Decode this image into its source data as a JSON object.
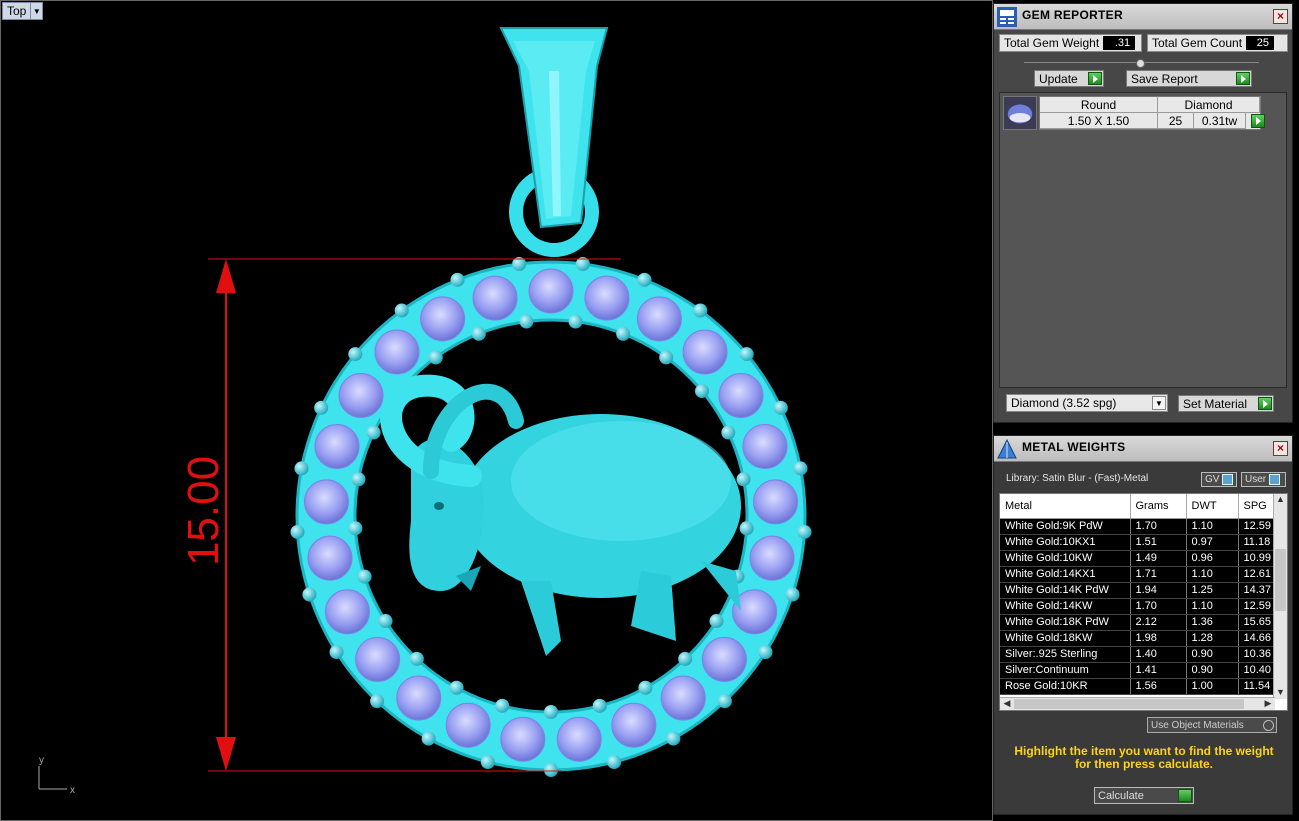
{
  "viewport": {
    "view_name": "Top",
    "dimension_value": "15.00",
    "axis_y": "y",
    "axis_x": "x"
  },
  "gem_reporter": {
    "title": "GEM REPORTER",
    "total_gem_weight_label": "Total Gem Weight",
    "total_gem_weight_value": ".31",
    "total_gem_count_label": "Total Gem Count",
    "total_gem_count_value": "25",
    "update_label": "Update",
    "save_report_label": "Save Report",
    "gems": [
      {
        "shape": "Round",
        "material": "Diamond",
        "size": "1.50 X 1.50",
        "count": "25",
        "weight": "0.31tw"
      }
    ],
    "material_select": "Diamond    (3.52 spg)",
    "set_material_label": "Set Material"
  },
  "metal_weights": {
    "title": "METAL WEIGHTS",
    "library": "Library: Satin Blur - (Fast)-Metal",
    "gv_label": "GV",
    "user_label": "User",
    "columns": [
      "Metal",
      "Grams",
      "DWT",
      "SPG"
    ],
    "rows": [
      [
        "White Gold:9K PdW",
        "1.70",
        "1.10",
        "12.59"
      ],
      [
        "White Gold:10KX1",
        "1.51",
        "0.97",
        "11.18"
      ],
      [
        "White Gold:10KW",
        "1.49",
        "0.96",
        "10.99"
      ],
      [
        "White Gold:14KX1",
        "1.71",
        "1.10",
        "12.61"
      ],
      [
        "White Gold:14K PdW",
        "1.94",
        "1.25",
        "14.37"
      ],
      [
        "White Gold:14KW",
        "1.70",
        "1.10",
        "12.59"
      ],
      [
        "White Gold:18K PdW",
        "2.12",
        "1.36",
        "15.65"
      ],
      [
        "White Gold:18KW",
        "1.98",
        "1.28",
        "14.66"
      ],
      [
        "Silver:.925 Sterling",
        "1.40",
        "0.90",
        "10.36"
      ],
      [
        "Silver:Continuum",
        "1.41",
        "0.90",
        "10.40"
      ],
      [
        "Rose Gold:10KR",
        "1.56",
        "1.00",
        "11.54"
      ]
    ],
    "use_object_materials": "Use Object Materials",
    "instructions": "Highlight the item you want to find the weight for then press calculate.",
    "calculate_label": "Calculate"
  }
}
